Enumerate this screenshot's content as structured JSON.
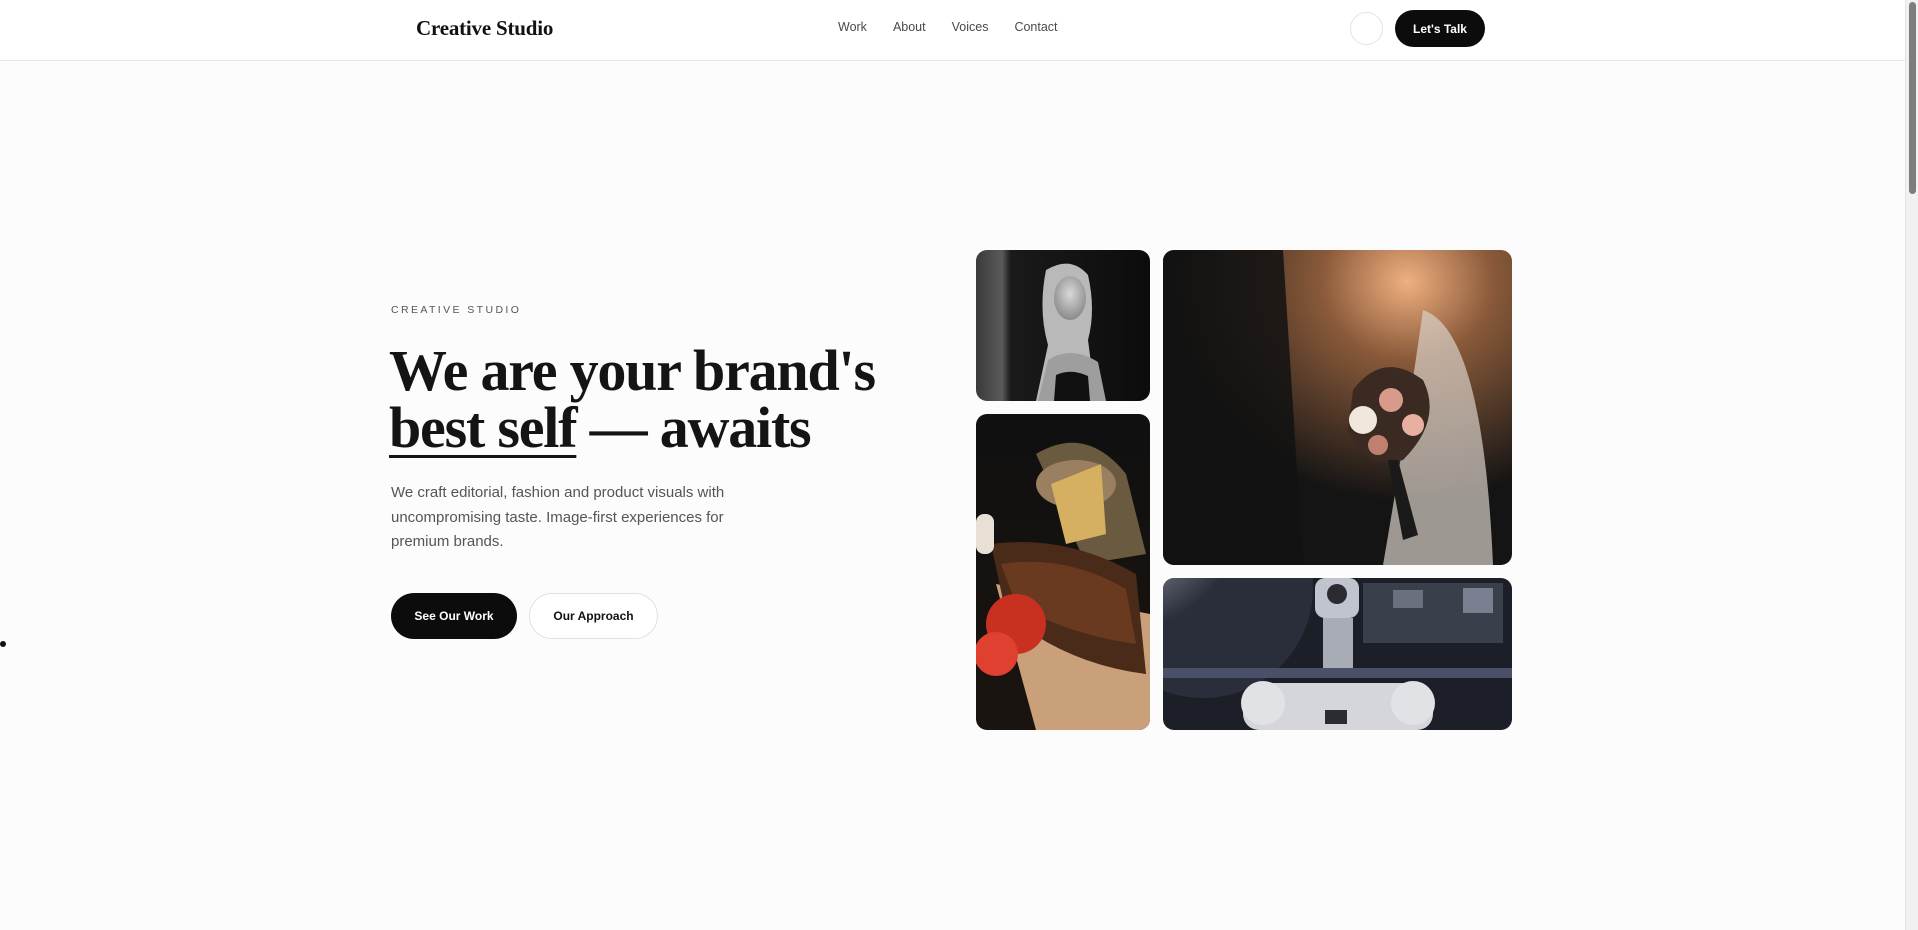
{
  "header": {
    "brand": "Creative Studio",
    "nav": [
      "Work",
      "About",
      "Voices",
      "Contact"
    ],
    "theme_toggle_icon": "moon-icon",
    "cta_label": "Let's Talk"
  },
  "hero": {
    "eyebrow": "CREATIVE STUDIO",
    "headline_line1": "We are your brand's",
    "headline_underlined": "best self",
    "headline_rest": " — awaits",
    "lead": "We craft editorial, fashion and product visuals with uncompromising taste. Image-first experiences for premium brands.",
    "primary_button": "See Our Work",
    "secondary_button": "Our Approach"
  },
  "gallery": {
    "images": [
      "portrait-photo",
      "food-photo",
      "wedding-bouquet-photo",
      "robot-photo"
    ]
  },
  "colors": {
    "background": "#fcfcfc",
    "ink": "#0c0c0c",
    "muted": "#555555",
    "moon": "#f2c200"
  }
}
